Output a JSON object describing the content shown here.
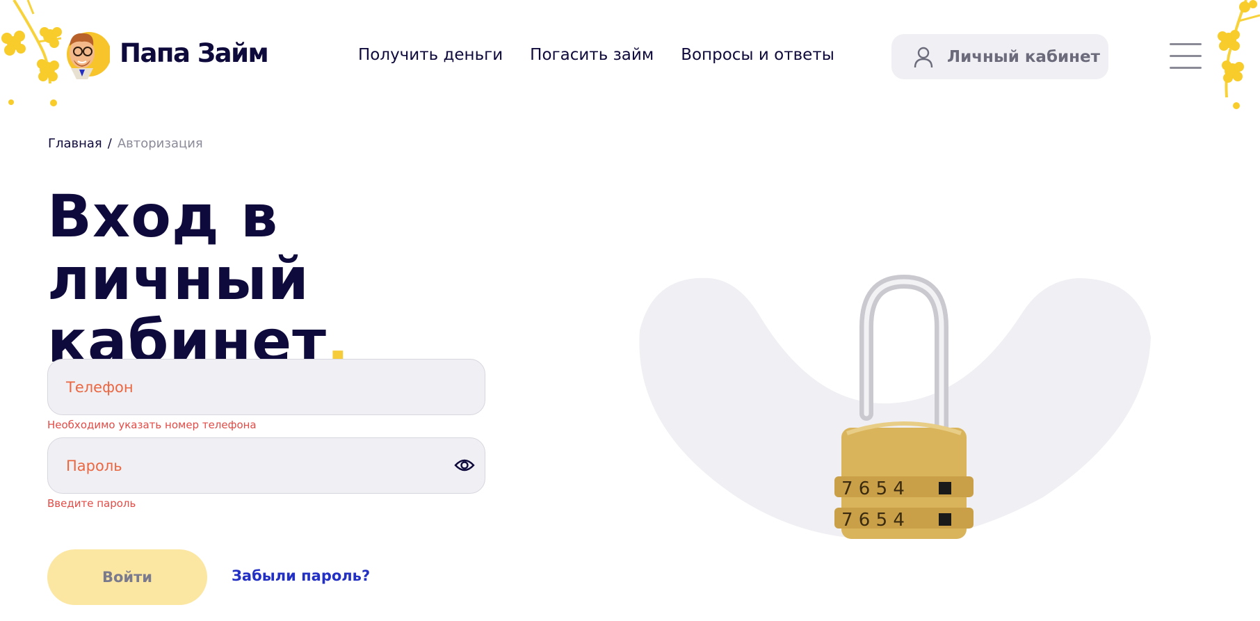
{
  "header": {
    "logo_text": "Папа Займ",
    "nav": [
      {
        "label": "Получить деньги"
      },
      {
        "label": "Погасить займ"
      },
      {
        "label": "Вопросы и ответы"
      }
    ],
    "cabinet_label": "Личный кабинет"
  },
  "breadcrumb": {
    "home": "Главная",
    "separator": "/",
    "current": "Авторизация"
  },
  "page": {
    "title_line1": "Вход в личный",
    "title_line2": "кабинет",
    "title_dot": "."
  },
  "form": {
    "phone_placeholder": "Телефон",
    "phone_error": "Необходимо указать номер телефона",
    "password_placeholder": "Пароль",
    "password_error": "Введите пароль",
    "submit_label": "Войти",
    "forgot_label": "Забыли пароль?"
  },
  "colors": {
    "brand_dark": "#0f0a3c",
    "accent_yellow": "#f7cc3b",
    "error_red": "#e24b46",
    "link_blue": "#2330c4",
    "field_bg": "#efeff4"
  },
  "icons": [
    "mascot-logo",
    "user-icon",
    "menu-icon",
    "eye-icon",
    "padlock-illustration",
    "flower-decoration"
  ]
}
